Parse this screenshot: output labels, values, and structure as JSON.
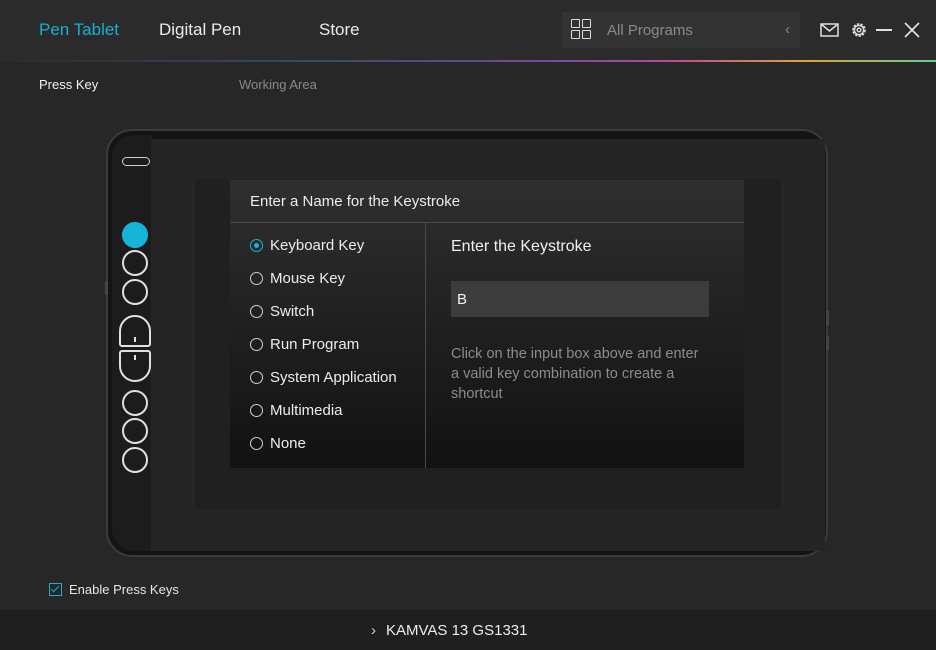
{
  "header": {
    "tabs": [
      {
        "label": "Pen Tablet",
        "active": true
      },
      {
        "label": "Digital Pen",
        "active": false
      },
      {
        "label": "Store",
        "active": false
      }
    ],
    "programs": {
      "label": "All Programs",
      "icon": "grid-icon"
    },
    "window_icons": [
      "mail-icon",
      "gear-icon",
      "minimize-icon",
      "close-icon"
    ]
  },
  "subtabs": [
    {
      "label": "Press Key",
      "active": true
    },
    {
      "label": "Working Area",
      "active": false
    }
  ],
  "tablet": {
    "express_keys": 8,
    "selected_key": 1
  },
  "dialog": {
    "title": "Enter a Name for the Keystroke",
    "options": [
      {
        "label": "Keyboard Key",
        "selected": true
      },
      {
        "label": "Mouse Key",
        "selected": false
      },
      {
        "label": "Switch",
        "selected": false
      },
      {
        "label": "Run Program",
        "selected": false
      },
      {
        "label": "System Application",
        "selected": false
      },
      {
        "label": "Multimedia",
        "selected": false
      },
      {
        "label": "None",
        "selected": false
      }
    ],
    "keystroke_title": "Enter the Keystroke",
    "keystroke_value": "B",
    "help_text": "Click on the input box above and enter a valid key combination to create a shortcut"
  },
  "enable_press_keys": {
    "label": "Enable Press Keys",
    "checked": true
  },
  "footer": {
    "device": "KAMVAS 13 GS1331"
  },
  "colors": {
    "accent": "#17b1d4",
    "background": "#272727",
    "topbar": "#2b2b2b"
  }
}
